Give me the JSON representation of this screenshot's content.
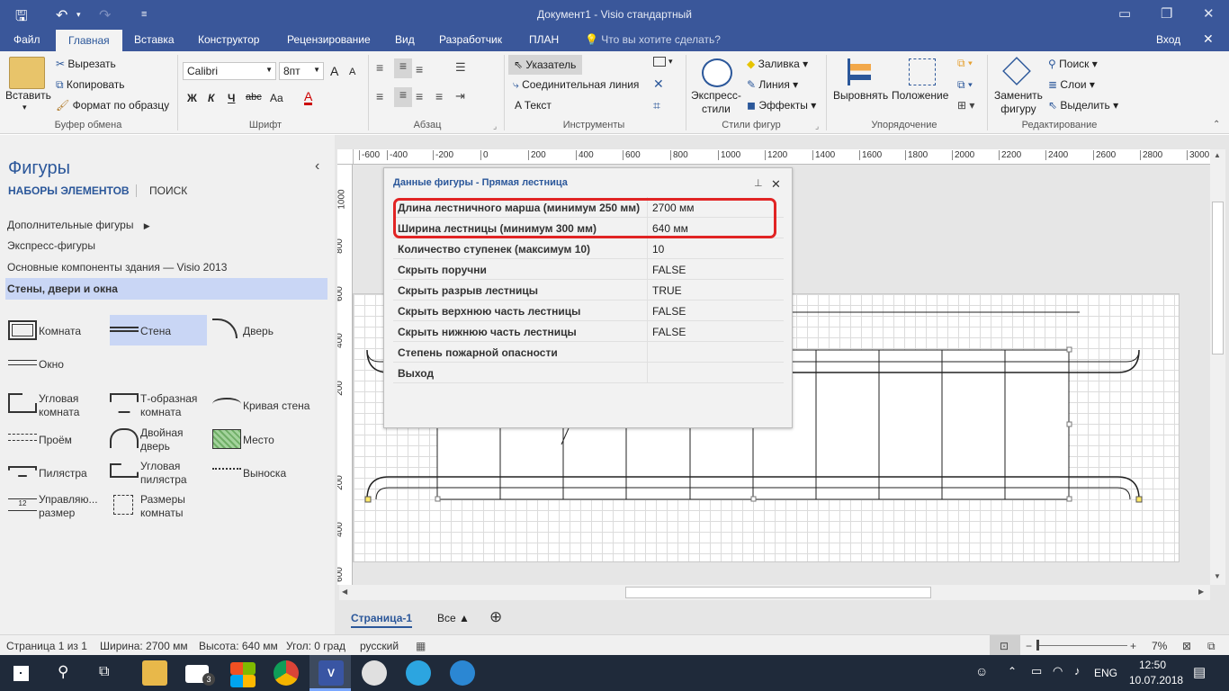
{
  "window": {
    "title": "Документ1 - Visio стандартный",
    "minimize": "‒",
    "restore": "❐",
    "close": "✕"
  },
  "tabs": [
    "Файл",
    "Главная",
    "Вставка",
    "Конструктор",
    "Рецензирование",
    "Вид",
    "Разработчик",
    "ПЛАН"
  ],
  "tell_me": "Что вы хотите сделать?",
  "signin": "Вход",
  "ribbon": {
    "clipboard": {
      "paste": "Вставить",
      "cut": "Вырезать",
      "copy": "Копировать",
      "format_painter": "Формат по образцу",
      "label": "Буфер обмена"
    },
    "font": {
      "name": "Calibri",
      "size": "8пт",
      "bold": "Ж",
      "italic": "К",
      "underline": "Ч",
      "strike": "abc",
      "case": "Aa",
      "grow": "A",
      "shrink": "A",
      "color": "A",
      "label": "Шрифт"
    },
    "paragraph": {
      "label": "Абзац"
    },
    "tools": {
      "pointer": "Указатель",
      "connector": "Соединительная линия",
      "text": "Текст",
      "label": "Инструменты"
    },
    "shape_styles": {
      "quick": "Экспресс-\nстили",
      "fill": "Заливка",
      "line": "Линия",
      "effects": "Эффекты",
      "label": "Стили фигур"
    },
    "arrange": {
      "align": "Выровнять",
      "position": "Положение",
      "label": "Упорядочение"
    },
    "editing": {
      "change_shape": "Заменить\nфигуру",
      "find": "Поиск",
      "layers": "Слои",
      "select": "Выделить",
      "label": "Редактирование"
    }
  },
  "shapes_panel": {
    "title": "Фигуры",
    "tab_sets": "НАБОРЫ ЭЛЕМЕНТОВ",
    "tab_search": "ПОИСК",
    "collapse": "‹",
    "stencils": [
      "Дополнительные фигуры",
      "Экспресс-фигуры",
      "Основные компоненты здания — Visio 2013",
      "Стены, двери и окна"
    ],
    "masters": [
      {
        "label": "Комната"
      },
      {
        "label": "Стена"
      },
      {
        "label": "Дверь"
      },
      {
        "label": "Окно"
      },
      {
        "label": "Угловая\nкомната"
      },
      {
        "label": "Т-образная\nкомната"
      },
      {
        "label": "Кривая стена"
      },
      {
        "label": "Проём"
      },
      {
        "label": "Двойная\nдверь"
      },
      {
        "label": "Место"
      },
      {
        "label": "Пилястра"
      },
      {
        "label": "Угловая\nпилястра"
      },
      {
        "label": "Выноска"
      },
      {
        "label": "Управляю...\nразмер"
      },
      {
        "label": "Размеры\nкомнаты"
      }
    ]
  },
  "ruler": {
    "h": [
      "-600",
      "-400",
      "-200",
      "0",
      "200",
      "400",
      "600",
      "800",
      "1000",
      "1200",
      "1400",
      "1600",
      "1800",
      "2000",
      "2200",
      "2400",
      "2600",
      "2800",
      "3000"
    ],
    "v": [
      "1000",
      "800",
      "600",
      "400",
      "200",
      "0",
      "200",
      "400",
      "600"
    ]
  },
  "shape_data": {
    "title": "Данные фигуры - Прямая лестница",
    "pin": "📌",
    "close": "✕",
    "rows": [
      {
        "key": "Длина лестничного марша (минимум 250 мм)",
        "value": "2700 мм"
      },
      {
        "key": "Ширина лестницы (минимум 300 мм)",
        "value": "640 мм"
      },
      {
        "key": "Количество ступенек (максимум 10)",
        "value": "10"
      },
      {
        "key": "Скрыть поручни",
        "value": "FALSE"
      },
      {
        "key": "Скрыть разрыв лестницы",
        "value": "TRUE"
      },
      {
        "key": "Скрыть верхнюю часть лестницы",
        "value": "FALSE"
      },
      {
        "key": "Скрыть нижнюю часть лестницы",
        "value": "FALSE"
      },
      {
        "key": "Степень пожарной опасности",
        "value": ""
      },
      {
        "key": "Выход",
        "value": ""
      }
    ]
  },
  "pagebar": {
    "page": "Страница-1",
    "all": "Все ▲",
    "add": "⊕"
  },
  "status": {
    "page": "Страница 1 из 1",
    "width": "Ширина: 2700 мм",
    "height": "Высота: 640 мм",
    "angle": "Угол: 0 град",
    "lang": "русский",
    "zoom": "7%"
  },
  "taskbar": {
    "lang": "ENG",
    "time": "12:50",
    "date": "10.07.2018",
    "mail_badge": "3"
  },
  "colors": {
    "accent": "#3a579a",
    "highlight": "#e12424",
    "selected_stencil": "#c9d6f5"
  }
}
